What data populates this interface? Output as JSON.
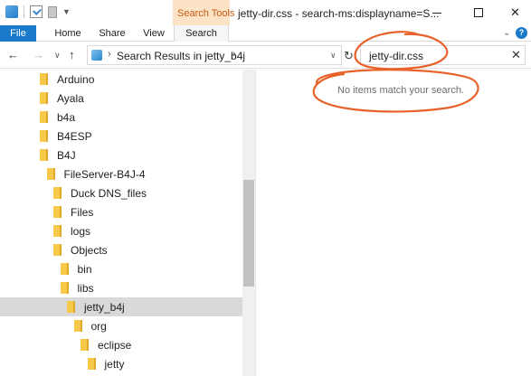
{
  "window": {
    "title": "jetty-dir.css - search-ms:displayname=S...",
    "contextual_tab_group": "Search Tools"
  },
  "ribbon": {
    "tabs": [
      "File",
      "Home",
      "Share",
      "View",
      "Search"
    ]
  },
  "nav": {
    "address_path": "Search Results in jetty_b4j",
    "search_value": "jetty-dir.css"
  },
  "tree": [
    {
      "label": "Arduino",
      "level": 0
    },
    {
      "label": "Ayala",
      "level": 0
    },
    {
      "label": "b4a",
      "level": 0
    },
    {
      "label": "B4ESP",
      "level": 0
    },
    {
      "label": "B4J",
      "level": 0
    },
    {
      "label": "FileServer-B4J-4",
      "level": 1
    },
    {
      "label": "Duck DNS_files",
      "level": 2
    },
    {
      "label": "Files",
      "level": 2
    },
    {
      "label": "logs",
      "level": 2
    },
    {
      "label": "Objects",
      "level": 2
    },
    {
      "label": "bin",
      "level": 3
    },
    {
      "label": "libs",
      "level": 3
    },
    {
      "label": "jetty_b4j",
      "level": 4,
      "selected": true
    },
    {
      "label": "org",
      "level": 5
    },
    {
      "label": "eclipse",
      "level": 6
    },
    {
      "label": "jetty",
      "level": 7
    }
  ],
  "content": {
    "empty_message": "No items match your search."
  },
  "colors": {
    "accent": "#1979ca",
    "search_tools_bg": "#fde3c5",
    "search_tools_text": "#c55a11",
    "annotation": "#e8622a",
    "folder": "#f6c94a",
    "selected_row": "#d9d9d9"
  },
  "icons": {
    "back": "back-arrow-icon",
    "forward": "forward-arrow-icon",
    "up": "up-arrow-icon",
    "refresh": "refresh-icon",
    "clear": "close-icon",
    "folder": "folder-icon"
  }
}
